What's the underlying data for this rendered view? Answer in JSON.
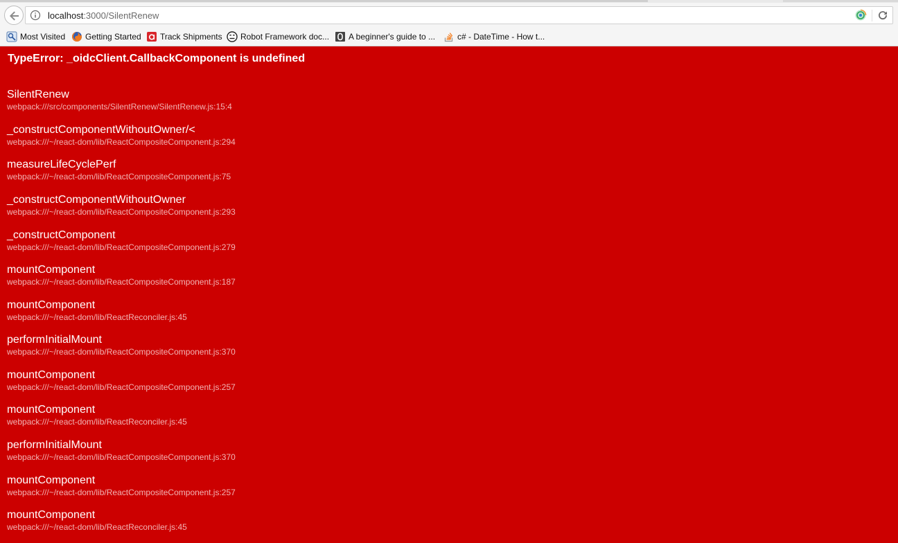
{
  "browser": {
    "url_host": "localhost",
    "url_rest": ":3000/SilentRenew",
    "bookmarks": [
      {
        "label": "Most Visited",
        "icon": "most-visited-icon"
      },
      {
        "label": "Getting Started",
        "icon": "firefox-icon"
      },
      {
        "label": "Track Shipments",
        "icon": "track-shipments-icon"
      },
      {
        "label": "Robot Framework doc...",
        "icon": "robot-framework-icon"
      },
      {
        "label": "A beginner's guide to ...",
        "icon": "page-icon"
      },
      {
        "label": "c# - DateTime - How t...",
        "icon": "stackoverflow-icon"
      }
    ]
  },
  "error": {
    "title": "TypeError: _oidcClient.CallbackComponent is undefined",
    "frames": [
      {
        "fn": "SilentRenew",
        "loc": "webpack:///src/components/SilentRenew/SilentRenew.js:15:4"
      },
      {
        "fn": "_constructComponentWithoutOwner/<",
        "loc": "webpack:///~/react-dom/lib/ReactCompositeComponent.js:294"
      },
      {
        "fn": "measureLifeCyclePerf",
        "loc": "webpack:///~/react-dom/lib/ReactCompositeComponent.js:75"
      },
      {
        "fn": "_constructComponentWithoutOwner",
        "loc": "webpack:///~/react-dom/lib/ReactCompositeComponent.js:293"
      },
      {
        "fn": "_constructComponent",
        "loc": "webpack:///~/react-dom/lib/ReactCompositeComponent.js:279"
      },
      {
        "fn": "mountComponent",
        "loc": "webpack:///~/react-dom/lib/ReactCompositeComponent.js:187"
      },
      {
        "fn": "mountComponent",
        "loc": "webpack:///~/react-dom/lib/ReactReconciler.js:45"
      },
      {
        "fn": "performInitialMount",
        "loc": "webpack:///~/react-dom/lib/ReactCompositeComponent.js:370"
      },
      {
        "fn": "mountComponent",
        "loc": "webpack:///~/react-dom/lib/ReactCompositeComponent.js:257"
      },
      {
        "fn": "mountComponent",
        "loc": "webpack:///~/react-dom/lib/ReactReconciler.js:45"
      },
      {
        "fn": "performInitialMount",
        "loc": "webpack:///~/react-dom/lib/ReactCompositeComponent.js:370"
      },
      {
        "fn": "mountComponent",
        "loc": "webpack:///~/react-dom/lib/ReactCompositeComponent.js:257"
      },
      {
        "fn": "mountComponent",
        "loc": "webpack:///~/react-dom/lib/ReactReconciler.js:45"
      }
    ]
  },
  "colors": {
    "background": "#cc0000",
    "text": "#ffffff",
    "location_text": "#f2b3b3"
  }
}
